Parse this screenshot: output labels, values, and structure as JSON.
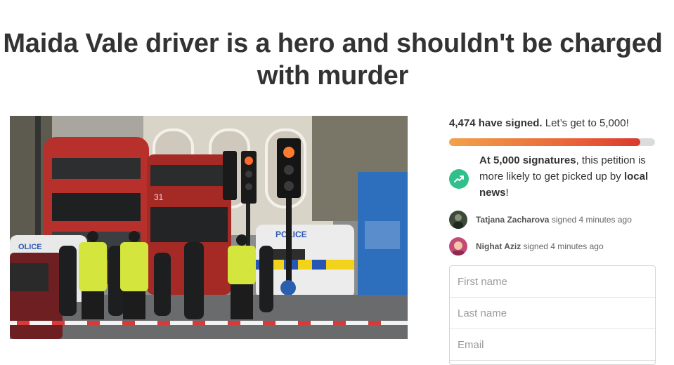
{
  "petition": {
    "title": "Maida Vale driver is a hero and shouldn't be charged with murder"
  },
  "photo": {
    "bus_route_number": "31",
    "police_van_text": "POLICE",
    "police_car_text": "OLICE"
  },
  "progress": {
    "signed_count": "4,474 have signed.",
    "goal_text": "Let’s get to 5,000!",
    "fraction": 0.93
  },
  "callout": {
    "bold_target": "At 5,000 signatures",
    "text_mid": ", this petition is more likely to get picked up by",
    "bold_audience": "local news",
    "text_end": "!",
    "icon": "trending-up-icon"
  },
  "recent_signers": [
    {
      "name": "Tatjana Zacharova",
      "action": "signed 4 minutes ago"
    },
    {
      "name": "Nighat Aziz",
      "action": "signed 4 minutes ago"
    }
  ],
  "form": {
    "first_name_placeholder": "First name",
    "last_name_placeholder": "Last name",
    "email_placeholder": "Email"
  },
  "colors": {
    "accent_green": "#2fc08b",
    "progress_start": "#f2a24a",
    "progress_end": "#d83a2d"
  }
}
